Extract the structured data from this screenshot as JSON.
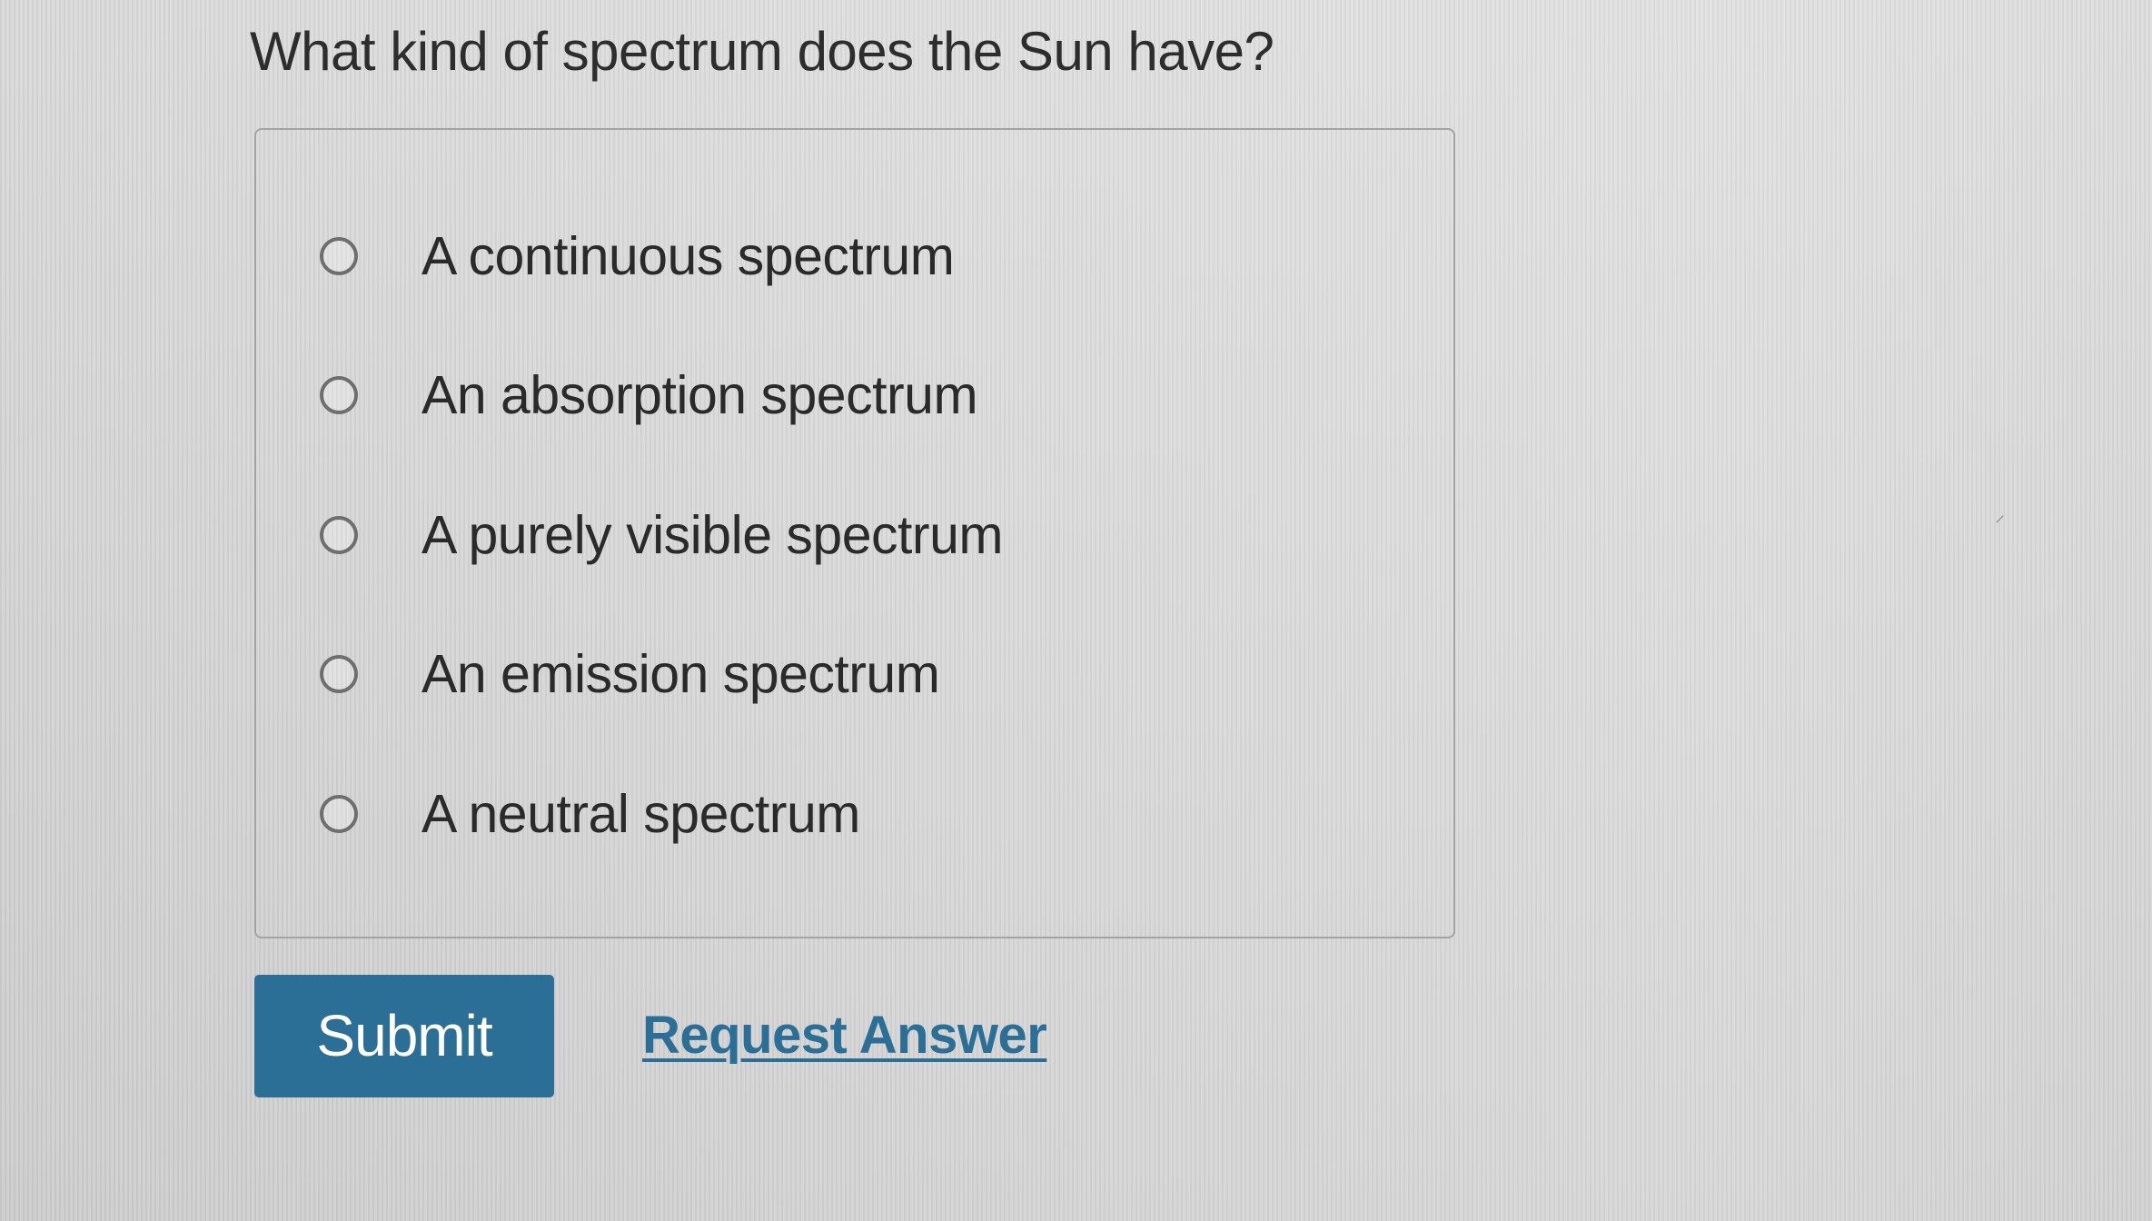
{
  "question": {
    "text": "What kind of spectrum does the Sun have?"
  },
  "choices": [
    {
      "label": "A continuous spectrum",
      "selected": false
    },
    {
      "label": "An absorption spectrum",
      "selected": false
    },
    {
      "label": "A purely visible spectrum",
      "selected": false
    },
    {
      "label": "An emission spectrum",
      "selected": false
    },
    {
      "label": "A neutral spectrum",
      "selected": false
    }
  ],
  "actions": {
    "submit_label": "Submit",
    "request_answer_label": "Request Answer"
  },
  "colors": {
    "accent": "#2b6f96",
    "button_text": "#ffffff",
    "text": "#2b2b2b",
    "border": "#a3a3a3"
  },
  "icons": {
    "radio": "radio-button-unchecked-icon"
  }
}
